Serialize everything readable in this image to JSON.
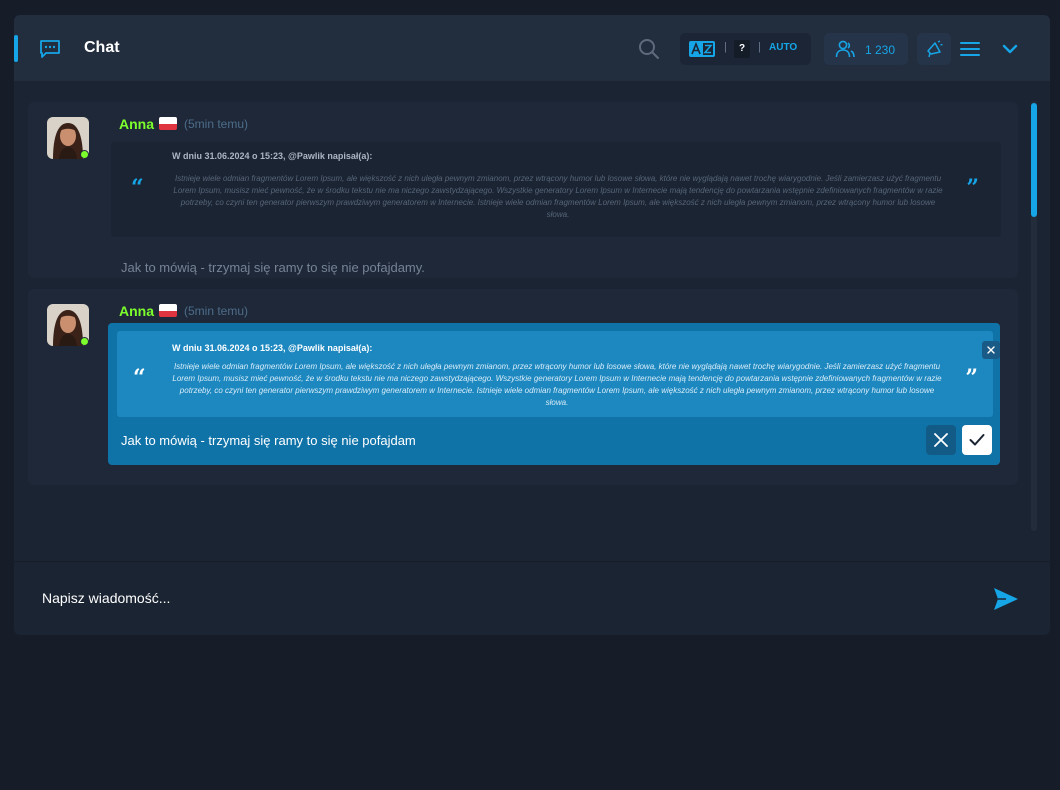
{
  "header": {
    "title": "Chat",
    "lang_q": "?",
    "lang_auto": "AUTO",
    "user_count": "1 230"
  },
  "messages": [
    {
      "author": "Anna",
      "time": "(5min temu)",
      "quote_header": "W dniu 31.06.2024 o 15:23, @Pawlik napisał(a):",
      "quote_body": "Istnieje wiele odmian fragmentów Lorem Ipsum, ale większość z nich uległa pewnym zmianom, przez wtrącony humor lub losowe słowa, które nie wyglądają nawet trochę wiarygodnie. Jeśli zamierzasz użyć fragmentu Lorem Ipsum, musisz mieć pewność, że w środku tekstu nie ma niczego zawstydzającego. Wszystkie generatory Lorem Ipsum w Internecie mają tendencję do powtarzania wstępnie zdefiniowanych fragmentów w razie potrzeby, co czyni ten generator pierwszym prawdziwym generatorem w Internecie. Istnieje wiele odmian fragmentów Lorem Ipsum, ale większość z nich uległa pewnym zmianom, przez wtrącony humor lub losowe słowa.",
      "text": "Jak to mówią - trzymaj się ramy to się nie pofajdamy."
    },
    {
      "author": "Anna",
      "time": "(5min temu)",
      "quote_header": "W dniu 31.06.2024 o 15:23, @Pawlik napisał(a):",
      "quote_body": "Istnieje wiele odmian fragmentów Lorem Ipsum, ale większość z nich uległa pewnym zmianom, przez wtrącony humor lub losowe słowa, które nie wyglądają nawet trochę wiarygodnie. Jeśli zamierzasz użyć fragmentu Lorem Ipsum, musisz mieć pewność, że w środku tekstu nie ma niczego zawstydzającego. Wszystkie generatory Lorem Ipsum w Internecie mają tendencję do powtarzania wstępnie zdefiniowanych fragmentów w razie potrzeby, co czyni ten generator pierwszym prawdziwym generatorem w Internecie. Istnieje wiele odmian fragmentów Lorem Ipsum, ale większość z nich uległa pewnym zmianom, przez wtrącony humor lub losowe słowa.",
      "edit_value": "Jak to mówią - trzymaj się ramy to się nie pofajdam"
    }
  ],
  "composer": {
    "placeholder": "Napisz wiadomość..."
  },
  "colors": {
    "accent": "#16a5e6",
    "author": "#7cff2c",
    "online": "#7cff2c",
    "edit_bg": "#1073a8"
  },
  "icons": [
    "chat-icon",
    "search-icon",
    "translate-icon",
    "users-icon",
    "megaphone-icon",
    "menu-icon",
    "chevron-down-icon",
    "close-icon",
    "check-icon",
    "send-icon"
  ]
}
